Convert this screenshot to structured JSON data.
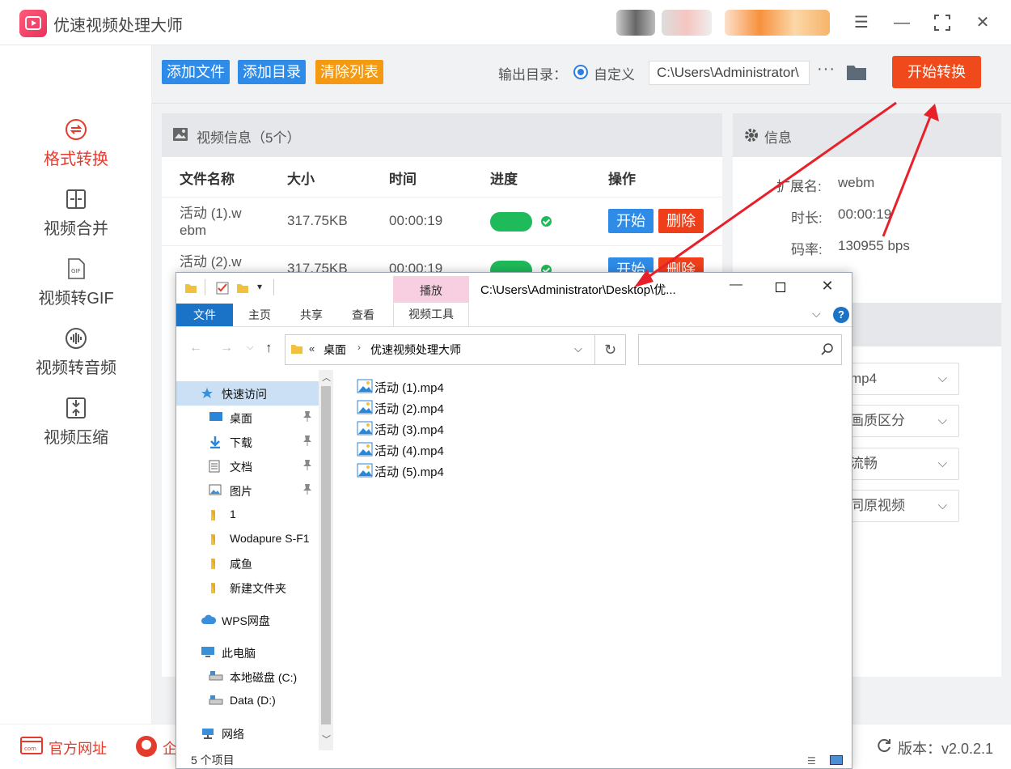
{
  "app": {
    "title": "优速视频处理大师"
  },
  "sidebar": {
    "items": [
      {
        "label": "格式转换",
        "icon": "format-convert-icon",
        "active": true
      },
      {
        "label": "视频合并",
        "icon": "merge-icon"
      },
      {
        "label": "视频转GIF",
        "icon": "gif-icon"
      },
      {
        "label": "视频转音频",
        "icon": "audio-icon"
      },
      {
        "label": "视频压缩",
        "icon": "compress-icon"
      }
    ]
  },
  "toolbar": {
    "add_file": "添加文件",
    "add_dir": "添加目录",
    "clear_list": "清除列表",
    "output_label": "输出目录：",
    "custom_label": "自定义",
    "output_path": "C:\\Users\\Administrator\\",
    "more": "···",
    "start_convert": "开始转换"
  },
  "video_panel": {
    "title": "视频信息（5个）",
    "columns": [
      "文件名称",
      "大小",
      "时间",
      "进度",
      "操作"
    ],
    "rows": [
      {
        "name_line1": "活动 (1).w",
        "name_line2": "ebm",
        "size": "317.75KB",
        "time": "00:00:19",
        "start": "开始",
        "delete": "删除"
      },
      {
        "name_line1": "活动 (2).w",
        "name_line2": "",
        "size": "317.75KB",
        "time": "00:00:19",
        "start": "开始",
        "delete": "删除"
      }
    ]
  },
  "info_panel": {
    "title": "信息",
    "ext_label": "扩展名:",
    "ext_value": "webm",
    "duration_label": "时长:",
    "duration_value": "00:00:19",
    "bitrate_label": "码率:",
    "bitrate_value": "130955 bps",
    "selects": [
      "mp4",
      "画质区分",
      "流畅",
      "同原视频"
    ]
  },
  "footer": {
    "website": "官方网址",
    "enterprise": "企",
    "version": "版本：v2.0.2.1"
  },
  "explorer": {
    "ribbon_context_group": "播放",
    "path_title": "C:\\Users\\Administrator\\Desktop\\优...",
    "tabs": [
      "文件",
      "主页",
      "共享",
      "查看",
      "视频工具"
    ],
    "breadcrumb": [
      "«",
      "桌面",
      "优速视频处理大师"
    ],
    "nav_tree": [
      {
        "label": "快速访问",
        "level": 0,
        "pinned": false,
        "selected": true,
        "icon": "star-icon"
      },
      {
        "label": "桌面",
        "level": 1,
        "pinned": true,
        "icon": "desktop-icon"
      },
      {
        "label": "下载",
        "level": 1,
        "pinned": true,
        "icon": "download-icon"
      },
      {
        "label": "文档",
        "level": 1,
        "pinned": true,
        "icon": "document-icon"
      },
      {
        "label": "图片",
        "level": 1,
        "pinned": true,
        "icon": "picture-icon"
      },
      {
        "label": "1",
        "level": 1,
        "pinned": false,
        "icon": "folder-icon"
      },
      {
        "label": "Wodapure S-F1",
        "level": 1,
        "pinned": false,
        "icon": "folder-icon"
      },
      {
        "label": "咸鱼",
        "level": 1,
        "pinned": false,
        "icon": "folder-icon"
      },
      {
        "label": "新建文件夹",
        "level": 1,
        "pinned": false,
        "icon": "folder-icon"
      },
      {
        "label": "WPS网盘",
        "level": 0,
        "pinned": false,
        "icon": "cloud-icon"
      },
      {
        "label": "此电脑",
        "level": 0,
        "pinned": false,
        "icon": "computer-icon"
      },
      {
        "label": "本地磁盘 (C:)",
        "level": 1,
        "pinned": false,
        "icon": "drive-icon"
      },
      {
        "label": "Data (D:)",
        "level": 1,
        "pinned": false,
        "icon": "drive-icon"
      },
      {
        "label": "网络",
        "level": 0,
        "pinned": false,
        "icon": "network-icon"
      }
    ],
    "files": [
      "活动 (1).mp4",
      "活动 (2).mp4",
      "活动 (3).mp4",
      "活动 (4).mp4",
      "活动 (5).mp4"
    ],
    "status": "5 个项目"
  },
  "colors": {
    "accent_red": "#e53b2c",
    "blue_btn": "#2e8ce8",
    "orange_btn": "#f39a12",
    "start_btn": "#f04a1c",
    "progress": "#1fba5a",
    "annotation_arrow": "#e8202a"
  }
}
